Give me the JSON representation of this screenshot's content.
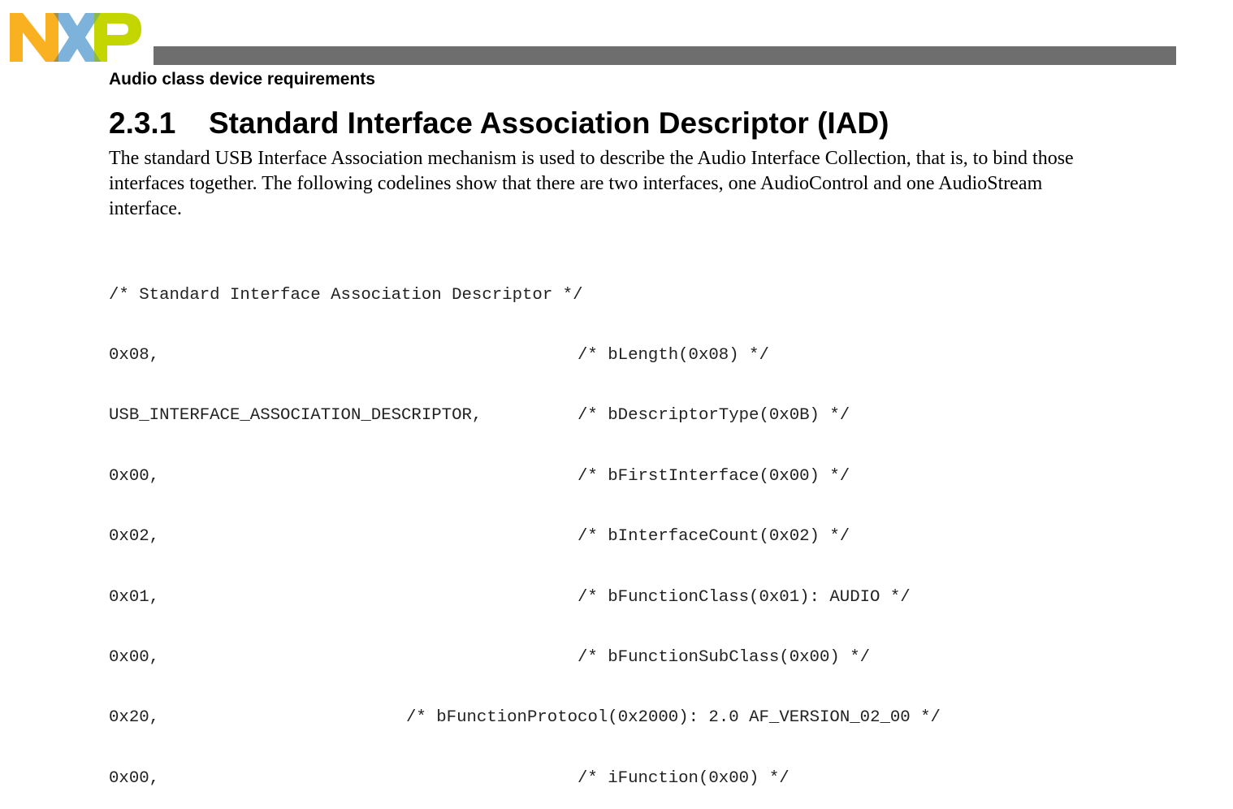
{
  "header": {
    "running_title": "Audio class device requirements"
  },
  "section": {
    "number": "2.3.1",
    "title": "Standard Interface Association Descriptor (IAD)"
  },
  "paragraph": {
    "lines": [
      "The standard USB Interface Association mechanism is used to describe the Audio Interface Collection, that is, to bind those",
      "interfaces together. The following codelines show that there are two interfaces, one AudioControl and one AudioStream",
      "interface."
    ]
  },
  "code": {
    "heading": "/* Standard Interface Association Descriptor */",
    "rows": [
      {
        "value": "0x08,",
        "comment": "/* bLength(0x08) */"
      },
      {
        "value": "USB_INTERFACE_ASSOCIATION_DESCRIPTOR,",
        "comment": "/* bDescriptorType(0x0B) */"
      },
      {
        "value": "0x00,",
        "comment": "/* bFirstInterface(0x00) */"
      },
      {
        "value": "0x02,",
        "comment": "/* bInterfaceCount(0x02) */"
      },
      {
        "value": "0x01,",
        "comment": "/* bFunctionClass(0x01): AUDIO */"
      },
      {
        "value": "0x00,",
        "comment": "/* bFunctionSubClass(0x00) */"
      },
      {
        "value": "0x20,",
        "comment": "/* bFunctionProtocol(0x2000): 2.0 AF_VERSION_02_00 */"
      },
      {
        "value": "0x00,",
        "comment": "/* iFunction(0x00) */"
      }
    ]
  },
  "colors": {
    "logo_orange": "#F9B122",
    "logo_blue": "#7DB3DA",
    "logo_green": "#C4D600",
    "header_bar": "#6E6E6E"
  }
}
